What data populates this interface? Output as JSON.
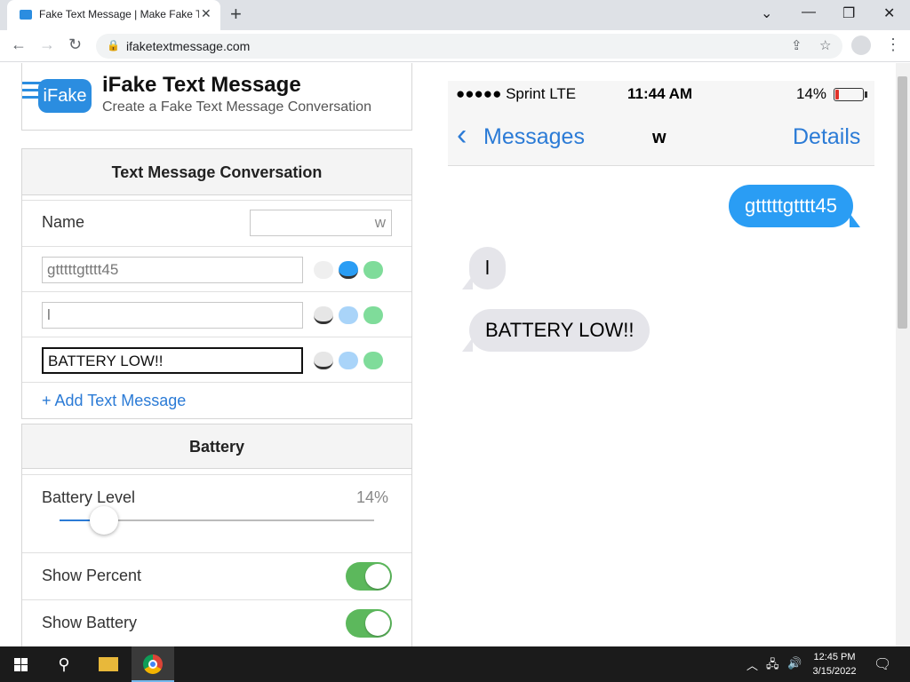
{
  "browser": {
    "tab_title": "Fake Text Message | Make Fake Te",
    "url": "ifaketextmessage.com"
  },
  "site": {
    "logo_text": "iFake",
    "title": "iFake Text Message",
    "subtitle": "Create a Fake Text Message Conversation"
  },
  "conversation": {
    "heading": "Text Message Conversation",
    "name_label": "Name",
    "name_value": "w",
    "messages": [
      {
        "text": "gtttttgtttt45"
      },
      {
        "text": "l"
      },
      {
        "text": "BATTERY LOW!!"
      }
    ],
    "add_label": "+ Add Text Message"
  },
  "battery": {
    "heading": "Battery",
    "level_label": "Battery Level",
    "level_value": "14%",
    "level_fraction": 0.14,
    "show_percent_label": "Show Percent",
    "show_battery_label": "Show Battery",
    "show_percent_on": true,
    "show_battery_on": true
  },
  "phone": {
    "carrier": "●●●●● Sprint  LTE",
    "time": "11:44 AM",
    "battery_pct": "14%",
    "back_label": "Messages",
    "contact": "w",
    "details_label": "Details",
    "bubbles": [
      {
        "text": "gtttttgtttt45",
        "side": "out"
      },
      {
        "text": "l",
        "side": "in"
      },
      {
        "text": "BATTERY LOW!!",
        "side": "in"
      }
    ]
  },
  "colors": {
    "ios_blue": "#2a9df4",
    "ios_green": "#5cb85c",
    "link_blue": "#2b7bd6"
  },
  "taskbar": {
    "time": "12:45 PM",
    "date": "3/15/2022"
  }
}
